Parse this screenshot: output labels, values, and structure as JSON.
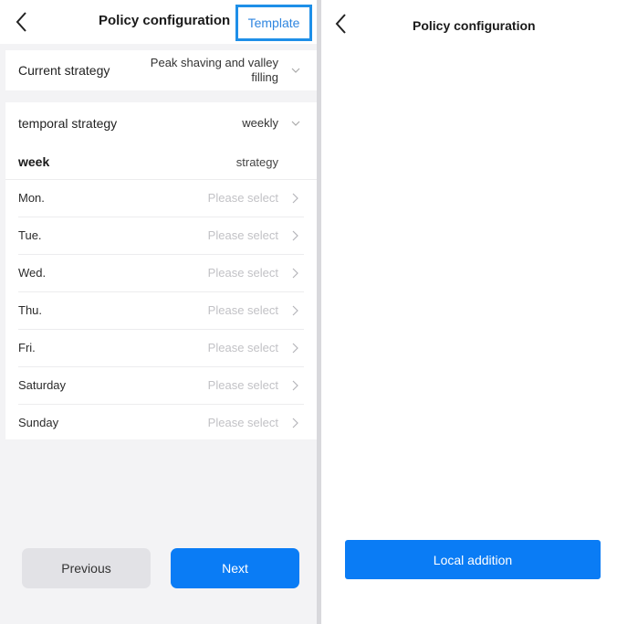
{
  "left": {
    "nav": {
      "title": "Policy configuration",
      "template_label": "Template"
    },
    "current_strategy": {
      "label": "Current strategy",
      "value_line1": "Peak shaving and valley",
      "value_line2": "filling"
    },
    "temporal_strategy": {
      "label": "temporal strategy",
      "value": "weekly"
    },
    "table_header": {
      "col1": "week",
      "col2": "strategy"
    },
    "days": [
      {
        "name": "Mon.",
        "value": "Please select"
      },
      {
        "name": "Tue.",
        "value": "Please select"
      },
      {
        "name": "Wed.",
        "value": "Please select"
      },
      {
        "name": "Thu.",
        "value": "Please select"
      },
      {
        "name": "Fri.",
        "value": "Please select"
      },
      {
        "name": "Saturday",
        "value": "Please select"
      },
      {
        "name": "Sunday",
        "value": "Please select"
      }
    ],
    "buttons": {
      "previous": "Previous",
      "next": "Next"
    }
  },
  "right": {
    "nav": {
      "title": "Policy configuration"
    },
    "local_addition_label": "Local addition"
  },
  "colors": {
    "accent": "#0a7cf5",
    "highlight_border": "#1e8fe8",
    "placeholder": "#c2c2c6",
    "page_bg": "#f3f3f5"
  },
  "icons": {
    "back": "chevron-left-icon",
    "dropdown": "chevron-down-icon",
    "row_arrow": "chevron-right-icon"
  }
}
